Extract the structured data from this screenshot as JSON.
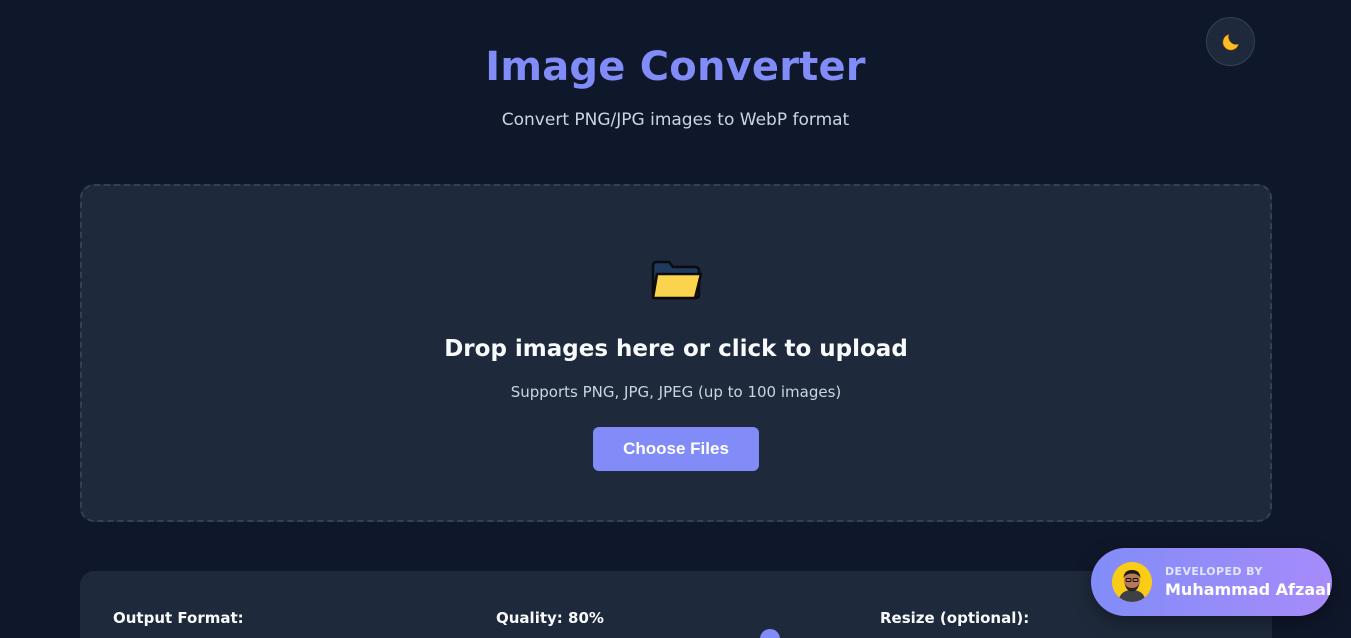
{
  "header": {
    "title": "Image Converter",
    "subtitle": "Convert PNG/JPG images to WebP format",
    "theme_icon": "moon-icon"
  },
  "dropzone": {
    "icon": "folder-icon",
    "title": "Drop images here or click to upload",
    "hint": "Supports PNG, JPG, JPEG (up to 100 images)",
    "button_label": "Choose Files"
  },
  "settings": {
    "output_format_label": "Output Format:",
    "quality_label": "Quality: 80%",
    "quality_value": 80,
    "resize_label": "Resize (optional):"
  },
  "developer": {
    "caption": "DEVELOPED BY",
    "name": "Muhammad Afzaal"
  },
  "colors": {
    "background": "#0f172a",
    "panel": "#1e293b",
    "accent": "#818cf8"
  }
}
